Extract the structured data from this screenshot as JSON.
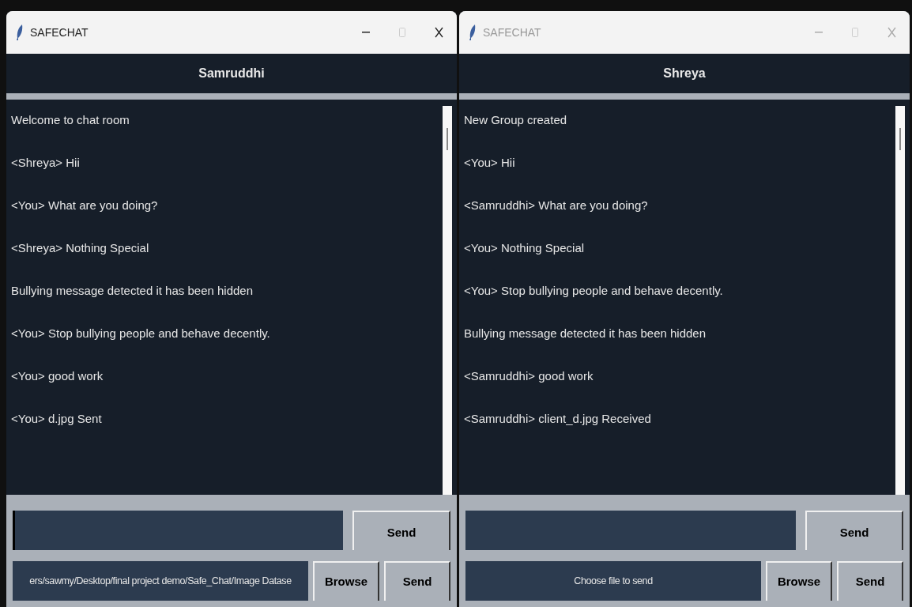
{
  "windows": [
    {
      "title": "SAFECHAT",
      "active": true,
      "header": "Samruddhi",
      "messages": [
        "Welcome to chat room",
        "<Shreya> Hii",
        "<You> What are you doing?",
        "<Shreya> Nothing Special",
        "Bullying message detected it has been hidden",
        "<You> Stop bullying people and behave decently.",
        "<You> good work",
        "<You> d.jpg Sent"
      ],
      "message_input": {
        "focused": true
      },
      "send_label": "Send",
      "file_label": "ers/sawmy/Desktop/final project demo/Safe_Chat/Image Datase",
      "browse_label": "Browse",
      "file_send_label": "Send"
    },
    {
      "title": "SAFECHAT",
      "active": false,
      "header": "Shreya",
      "messages": [
        "New Group created",
        "<You> Hii",
        "<Samruddhi> What are you doing?",
        "<You> Nothing Special",
        "<You> Stop bullying people and behave decently.",
        "Bullying message detected it has been hidden",
        "<Samruddhi> good work",
        "<Samruddhi> client_d.jpg Received"
      ],
      "message_input": {
        "focused": false
      },
      "send_label": "Send",
      "file_label": "Choose file to send",
      "browse_label": "Browse",
      "file_send_label": "Send"
    }
  ]
}
